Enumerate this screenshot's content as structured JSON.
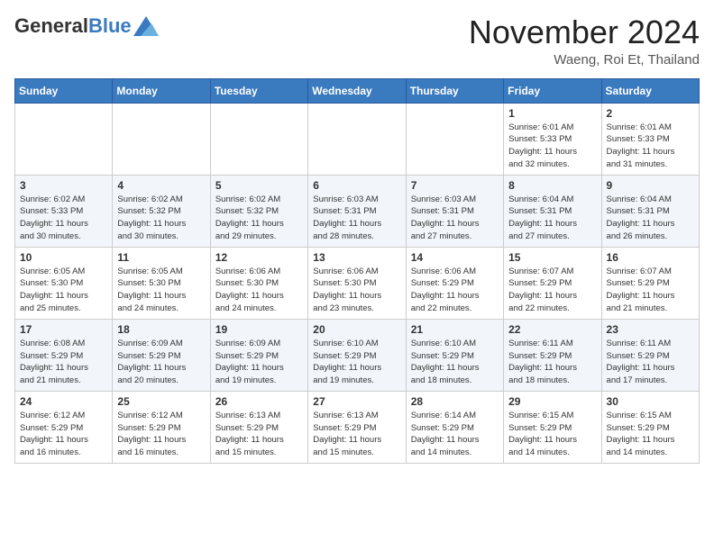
{
  "header": {
    "logo_general": "General",
    "logo_blue": "Blue",
    "month_title": "November 2024",
    "location": "Waeng, Roi Et, Thailand"
  },
  "weekdays": [
    "Sunday",
    "Monday",
    "Tuesday",
    "Wednesday",
    "Thursday",
    "Friday",
    "Saturday"
  ],
  "weeks": [
    [
      {
        "day": "",
        "info": ""
      },
      {
        "day": "",
        "info": ""
      },
      {
        "day": "",
        "info": ""
      },
      {
        "day": "",
        "info": ""
      },
      {
        "day": "",
        "info": ""
      },
      {
        "day": "1",
        "info": "Sunrise: 6:01 AM\nSunset: 5:33 PM\nDaylight: 11 hours\nand 32 minutes."
      },
      {
        "day": "2",
        "info": "Sunrise: 6:01 AM\nSunset: 5:33 PM\nDaylight: 11 hours\nand 31 minutes."
      }
    ],
    [
      {
        "day": "3",
        "info": "Sunrise: 6:02 AM\nSunset: 5:33 PM\nDaylight: 11 hours\nand 30 minutes."
      },
      {
        "day": "4",
        "info": "Sunrise: 6:02 AM\nSunset: 5:32 PM\nDaylight: 11 hours\nand 30 minutes."
      },
      {
        "day": "5",
        "info": "Sunrise: 6:02 AM\nSunset: 5:32 PM\nDaylight: 11 hours\nand 29 minutes."
      },
      {
        "day": "6",
        "info": "Sunrise: 6:03 AM\nSunset: 5:31 PM\nDaylight: 11 hours\nand 28 minutes."
      },
      {
        "day": "7",
        "info": "Sunrise: 6:03 AM\nSunset: 5:31 PM\nDaylight: 11 hours\nand 27 minutes."
      },
      {
        "day": "8",
        "info": "Sunrise: 6:04 AM\nSunset: 5:31 PM\nDaylight: 11 hours\nand 27 minutes."
      },
      {
        "day": "9",
        "info": "Sunrise: 6:04 AM\nSunset: 5:31 PM\nDaylight: 11 hours\nand 26 minutes."
      }
    ],
    [
      {
        "day": "10",
        "info": "Sunrise: 6:05 AM\nSunset: 5:30 PM\nDaylight: 11 hours\nand 25 minutes."
      },
      {
        "day": "11",
        "info": "Sunrise: 6:05 AM\nSunset: 5:30 PM\nDaylight: 11 hours\nand 24 minutes."
      },
      {
        "day": "12",
        "info": "Sunrise: 6:06 AM\nSunset: 5:30 PM\nDaylight: 11 hours\nand 24 minutes."
      },
      {
        "day": "13",
        "info": "Sunrise: 6:06 AM\nSunset: 5:30 PM\nDaylight: 11 hours\nand 23 minutes."
      },
      {
        "day": "14",
        "info": "Sunrise: 6:06 AM\nSunset: 5:29 PM\nDaylight: 11 hours\nand 22 minutes."
      },
      {
        "day": "15",
        "info": "Sunrise: 6:07 AM\nSunset: 5:29 PM\nDaylight: 11 hours\nand 22 minutes."
      },
      {
        "day": "16",
        "info": "Sunrise: 6:07 AM\nSunset: 5:29 PM\nDaylight: 11 hours\nand 21 minutes."
      }
    ],
    [
      {
        "day": "17",
        "info": "Sunrise: 6:08 AM\nSunset: 5:29 PM\nDaylight: 11 hours\nand 21 minutes."
      },
      {
        "day": "18",
        "info": "Sunrise: 6:09 AM\nSunset: 5:29 PM\nDaylight: 11 hours\nand 20 minutes."
      },
      {
        "day": "19",
        "info": "Sunrise: 6:09 AM\nSunset: 5:29 PM\nDaylight: 11 hours\nand 19 minutes."
      },
      {
        "day": "20",
        "info": "Sunrise: 6:10 AM\nSunset: 5:29 PM\nDaylight: 11 hours\nand 19 minutes."
      },
      {
        "day": "21",
        "info": "Sunrise: 6:10 AM\nSunset: 5:29 PM\nDaylight: 11 hours\nand 18 minutes."
      },
      {
        "day": "22",
        "info": "Sunrise: 6:11 AM\nSunset: 5:29 PM\nDaylight: 11 hours\nand 18 minutes."
      },
      {
        "day": "23",
        "info": "Sunrise: 6:11 AM\nSunset: 5:29 PM\nDaylight: 11 hours\nand 17 minutes."
      }
    ],
    [
      {
        "day": "24",
        "info": "Sunrise: 6:12 AM\nSunset: 5:29 PM\nDaylight: 11 hours\nand 16 minutes."
      },
      {
        "day": "25",
        "info": "Sunrise: 6:12 AM\nSunset: 5:29 PM\nDaylight: 11 hours\nand 16 minutes."
      },
      {
        "day": "26",
        "info": "Sunrise: 6:13 AM\nSunset: 5:29 PM\nDaylight: 11 hours\nand 15 minutes."
      },
      {
        "day": "27",
        "info": "Sunrise: 6:13 AM\nSunset: 5:29 PM\nDaylight: 11 hours\nand 15 minutes."
      },
      {
        "day": "28",
        "info": "Sunrise: 6:14 AM\nSunset: 5:29 PM\nDaylight: 11 hours\nand 14 minutes."
      },
      {
        "day": "29",
        "info": "Sunrise: 6:15 AM\nSunset: 5:29 PM\nDaylight: 11 hours\nand 14 minutes."
      },
      {
        "day": "30",
        "info": "Sunrise: 6:15 AM\nSunset: 5:29 PM\nDaylight: 11 hours\nand 14 minutes."
      }
    ]
  ]
}
